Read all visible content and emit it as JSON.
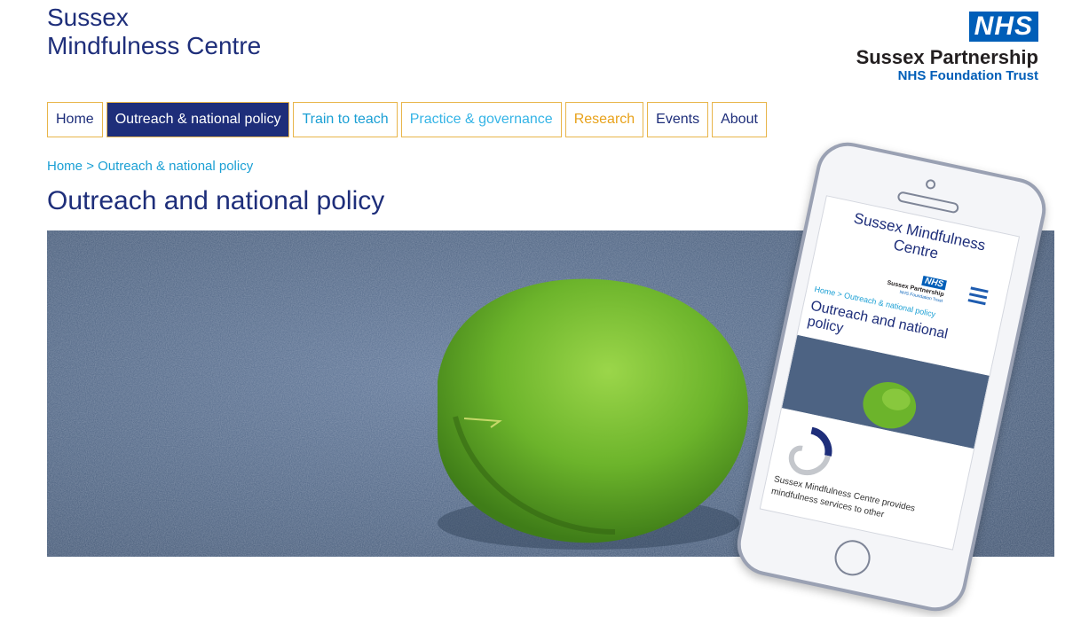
{
  "header": {
    "title_line1": "Sussex",
    "title_line2": "Mindfulness Centre",
    "logo": {
      "badge": "NHS",
      "org": "Sussex Partnership",
      "trust": "NHS Foundation Trust"
    }
  },
  "nav": {
    "items": [
      {
        "label": "Home"
      },
      {
        "label": "Outreach & national policy",
        "active": true
      },
      {
        "label": "Train to teach"
      },
      {
        "label": "Practice & governance"
      },
      {
        "label": "Research"
      },
      {
        "label": "Events"
      },
      {
        "label": "About"
      }
    ]
  },
  "breadcrumb": {
    "home": "Home",
    "separator": ">",
    "current": "Outreach & national policy"
  },
  "page": {
    "title": "Outreach and national policy"
  },
  "mobile": {
    "title": "Sussex Mindfulness Centre",
    "logo_badge": "NHS",
    "logo_org": "Sussex Partnership",
    "logo_trust": "NHS Foundation Trust",
    "breadcrumb": "Home > Outreach & national policy",
    "page_title": "Outreach and national policy",
    "body_text": "Sussex Mindfulness Centre provides mindfulness services to other"
  },
  "colors": {
    "brand_navy": "#1e2e7a",
    "nhs_blue": "#005eb8",
    "link_teal": "#1a9fd4",
    "nav_border_gold": "#e8b54a",
    "moss_green": "#6fb52e"
  }
}
